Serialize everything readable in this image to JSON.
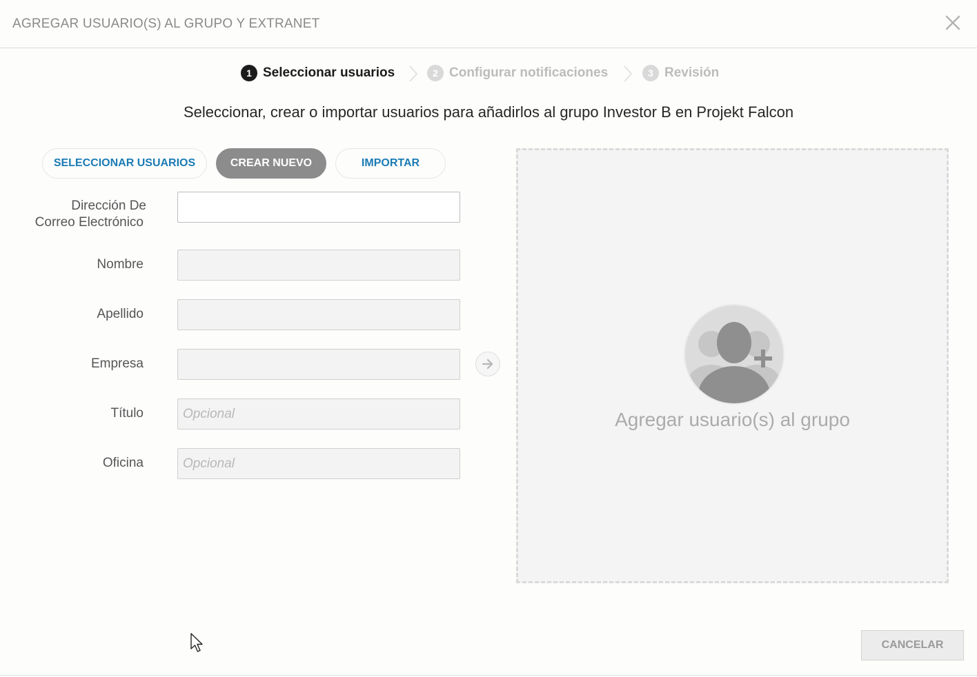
{
  "header": {
    "title": "AGREGAR USUARIO(S) AL GRUPO Y EXTRANET"
  },
  "stepper": {
    "steps": [
      {
        "number": "1",
        "label": "Seleccionar usuarios",
        "state": "active"
      },
      {
        "number": "2",
        "label": "Configurar notificaciones",
        "state": "inactive"
      },
      {
        "number": "3",
        "label": "Revisión",
        "state": "inactive"
      }
    ]
  },
  "subtitle": "Seleccionar, crear o importar usuarios para añadirlos al grupo Investor B en Projekt Falcon",
  "tabs": {
    "select_label": "SELECCIONAR USUARIOS",
    "create_label": "CREAR NUEVO",
    "import_label": "IMPORTAR",
    "active": "create"
  },
  "form": {
    "email": {
      "label_line1": "Dirección De",
      "label_line2": "Correo Electrónico",
      "value": "",
      "placeholder": ""
    },
    "first_name": {
      "label": "Nombre",
      "value": "",
      "placeholder": ""
    },
    "last_name": {
      "label": "Apellido",
      "value": "",
      "placeholder": ""
    },
    "company": {
      "label": "Empresa",
      "value": "",
      "placeholder": ""
    },
    "title": {
      "label": "Título",
      "value": "",
      "placeholder": "Opcional"
    },
    "office": {
      "label": "Oficina",
      "value": "",
      "placeholder": "Opcional"
    }
  },
  "drop_zone": {
    "label": "Agregar usuario(s) al grupo",
    "icon": "add-users-icon"
  },
  "footer": {
    "cancel_label": "CANCELAR"
  },
  "colors": {
    "accent_link": "#1a7bb5",
    "active_tab": "#8c8c8c",
    "step_active": "#1b1b1b",
    "step_inactive": "#bcbcbc"
  }
}
